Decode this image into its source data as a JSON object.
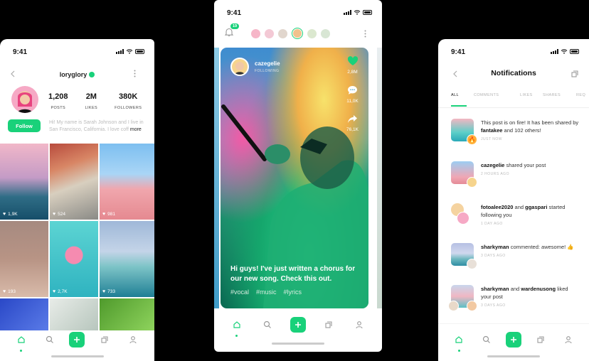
{
  "colors": {
    "accent": "#19d17a",
    "background": "#000000"
  },
  "status": {
    "time": "9:41"
  },
  "profile": {
    "username": "loryglory",
    "stats": [
      {
        "value": "1,208",
        "label": "POSTS"
      },
      {
        "value": "2M",
        "label": "LIKES"
      },
      {
        "value": "380K",
        "label": "FOLLOWERS"
      }
    ],
    "follow_label": "Follow",
    "bio": "Hi! My name is Sarah Johnson and I live in San Francisco, California. I love coff",
    "bio_more": "more",
    "grid": [
      {
        "likes": "1,9K"
      },
      {
        "likes": "524"
      },
      {
        "likes": "981"
      },
      {
        "likes": "193"
      },
      {
        "likes": "2,7K"
      },
      {
        "likes": "733"
      }
    ]
  },
  "feed": {
    "notification_count": "19",
    "creator_name": "cazegelie",
    "creator_status": "FOLLOWING",
    "likes": "2,8M",
    "comments": "11,0K",
    "shares": "76,1K",
    "caption": "Hi guys! I've just written a chorus for our new song. Check this out.",
    "tags": [
      "#vocal",
      "#music",
      "#lyrics"
    ]
  },
  "notifications": {
    "title": "Notifications",
    "tabs": [
      "ALL",
      "COMMENTS",
      "LIKES",
      "SHARES",
      "REQ"
    ],
    "items": [
      {
        "pre": "This post is on fire! It has been shared by ",
        "user": "fantakee",
        "post": " and 102 others!",
        "time": "JUST NOW"
      },
      {
        "pre": "",
        "user": "cazegelie",
        "post": " shared your post",
        "time": "2 HOURS AGO"
      },
      {
        "pre": "",
        "user": "fotoalee2020",
        "post": " and ",
        "user2": "ggaspari",
        "post2": " started following you",
        "time": "1 DAY AGO"
      },
      {
        "pre": "",
        "user": "sharkyman",
        "post": " commented: awesome! 👍",
        "time": "3 DAYS AGO"
      },
      {
        "pre": "",
        "user": "sharkyman",
        "post": " and ",
        "user2": "wardenusong",
        "post2": " liked your post",
        "time": "3 DAYS AGO"
      }
    ]
  },
  "icons": [
    "home-icon",
    "search-icon",
    "plus-icon",
    "layers-icon",
    "profile-icon",
    "bell-icon",
    "heart-icon",
    "comment-icon",
    "share-icon",
    "back-icon",
    "more-icon"
  ]
}
